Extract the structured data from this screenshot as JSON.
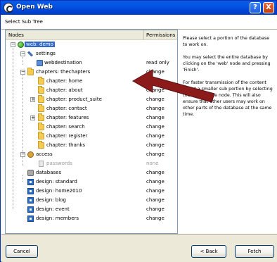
{
  "window": {
    "title": "Open Web",
    "help_label": "?",
    "close_label": "X"
  },
  "header": {
    "subtitle": "Select Sub Tree"
  },
  "tree": {
    "columns": {
      "nodes": "Nodes",
      "permissions": "Permissions"
    },
    "rows": [
      {
        "label": "web: demo",
        "perm": ""
      },
      {
        "label": "settings",
        "perm": ""
      },
      {
        "label": "webdestination",
        "perm": "read only"
      },
      {
        "label": "chapters: thechapters",
        "perm": "change"
      },
      {
        "label": "chapter: home",
        "perm": "change"
      },
      {
        "label": "chapter: about",
        "perm": "change"
      },
      {
        "label": "chapter: product_suite",
        "perm": "change"
      },
      {
        "label": "chapter: contact",
        "perm": "change"
      },
      {
        "label": "chapter: features",
        "perm": "change"
      },
      {
        "label": "chapter: search",
        "perm": "change"
      },
      {
        "label": "chapter: register",
        "perm": "change"
      },
      {
        "label": "chapter: thanks",
        "perm": "change"
      },
      {
        "label": "access",
        "perm": "change"
      },
      {
        "label": "passwords",
        "perm": "none"
      },
      {
        "label": "databases",
        "perm": "change"
      },
      {
        "label": "design: standard",
        "perm": "change"
      },
      {
        "label": "design: home2010",
        "perm": "change"
      },
      {
        "label": "design: blog",
        "perm": "change"
      },
      {
        "label": "design: event",
        "perm": "change"
      },
      {
        "label": "design: members",
        "perm": "change"
      }
    ]
  },
  "info": {
    "p1": "Please select a portion of the database to work on.",
    "p2": "You may select the entire database by clicking on the 'web' node and pressing 'Finish'.",
    "p3": "For faster transmission of the content select a smaller sub portion by selecting the appropriate node. This will also ensure that other users may work on other parts of the database at the same time."
  },
  "buttons": {
    "cancel": "Cancel",
    "back": "< Back",
    "fetch": "Fetch"
  },
  "colors": {
    "selection": "#316ac5",
    "arrow": "#8b1a1a",
    "titlebar": "#0553e1"
  }
}
